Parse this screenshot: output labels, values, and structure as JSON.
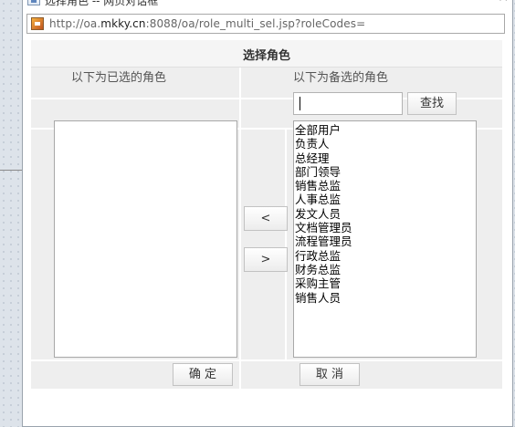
{
  "window": {
    "title": "选择角色 -- 网页对话框",
    "close_symbol": "×"
  },
  "address": {
    "url_prefix": "http://oa.",
    "url_domain": "mkky.cn",
    "url_rest": ":8088/oa/role_multi_sel.jsp?roleCodes="
  },
  "dialog": {
    "header": "选择角色",
    "left_title": "以下为已选的角色",
    "right_title": "以下为备选的角色",
    "search": {
      "value": "",
      "placeholder": ""
    },
    "search_button": "查找",
    "remove_button": "<",
    "add_button": ">",
    "selected_roles": [],
    "available_roles": [
      "全部用户",
      "负责人",
      "总经理",
      "部门领导",
      "销售总监",
      "人事总监",
      "发文人员",
      "文档管理员",
      "流程管理员",
      "行政总监",
      "财务总监",
      "采购主管",
      "销售人员"
    ],
    "ok_button": "确 定",
    "cancel_button": "取 消"
  },
  "icons": {
    "window": "dialog-window-icon",
    "address": "page-favicon-icon",
    "close": "close-icon"
  }
}
